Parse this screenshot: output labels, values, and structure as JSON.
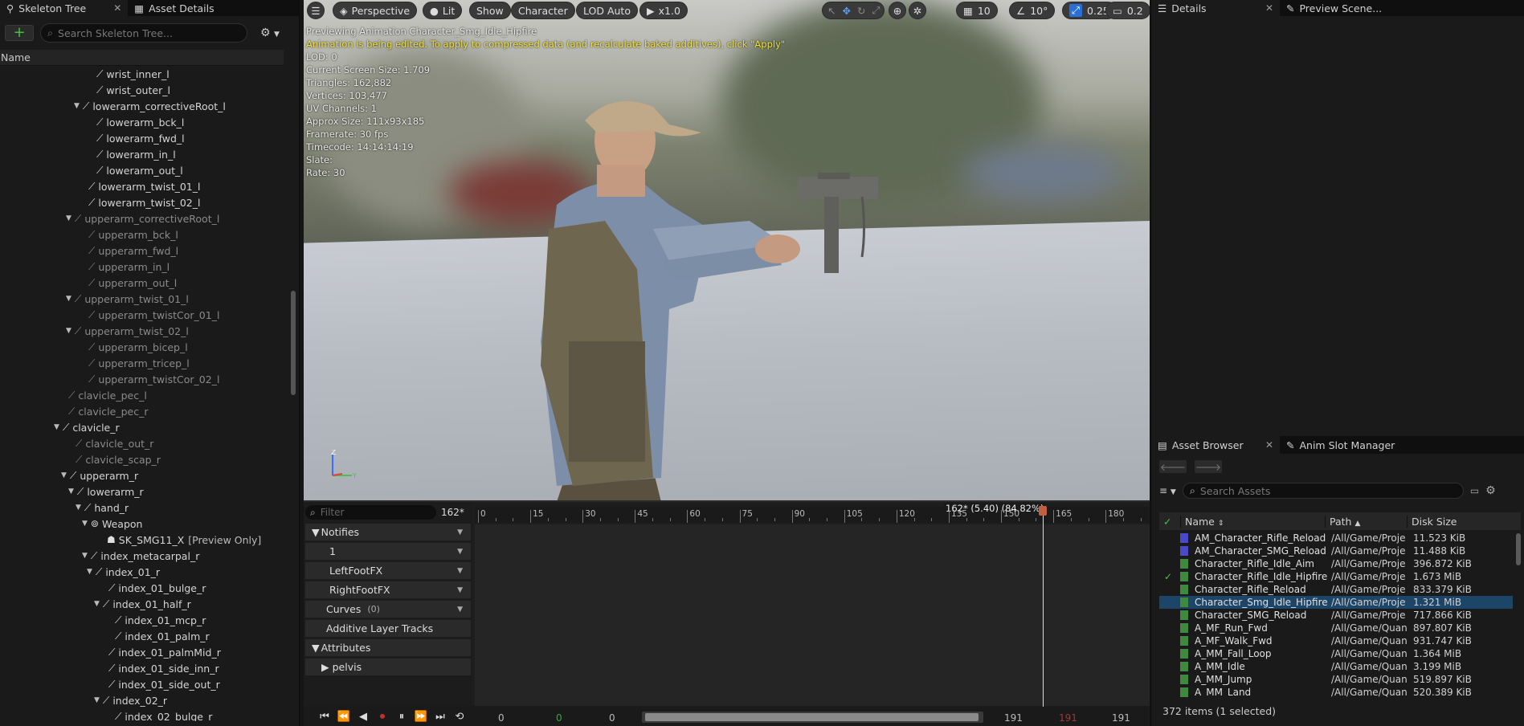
{
  "left_panel": {
    "tabs": [
      {
        "label": "Skeleton Tree"
      },
      {
        "label": "Asset Details"
      }
    ],
    "search_placeholder": "Search Skeleton Tree...",
    "column_header": "Name",
    "tree": [
      {
        "label": "wrist_inner_l",
        "dim": false
      },
      {
        "label": "wrist_outer_l",
        "dim": false
      },
      {
        "label": "lowerarm_correctiveRoot_l",
        "dim": false
      },
      {
        "label": "lowerarm_bck_l",
        "dim": false
      },
      {
        "label": "lowerarm_fwd_l",
        "dim": false
      },
      {
        "label": "lowerarm_in_l",
        "dim": false
      },
      {
        "label": "lowerarm_out_l",
        "dim": false
      },
      {
        "label": "lowerarm_twist_01_l",
        "dim": false
      },
      {
        "label": "lowerarm_twist_02_l",
        "dim": false
      },
      {
        "label": "upperarm_correctiveRoot_l",
        "dim": true
      },
      {
        "label": "upperarm_bck_l",
        "dim": true
      },
      {
        "label": "upperarm_fwd_l",
        "dim": true
      },
      {
        "label": "upperarm_in_l",
        "dim": true
      },
      {
        "label": "upperarm_out_l",
        "dim": true
      },
      {
        "label": "upperarm_twist_01_l",
        "dim": true
      },
      {
        "label": "upperarm_twistCor_01_l",
        "dim": true
      },
      {
        "label": "upperarm_twist_02_l",
        "dim": true
      },
      {
        "label": "upperarm_bicep_l",
        "dim": true
      },
      {
        "label": "upperarm_tricep_l",
        "dim": true
      },
      {
        "label": "upperarm_twistCor_02_l",
        "dim": true
      },
      {
        "label": "clavicle_pec_l",
        "dim": true
      },
      {
        "label": "clavicle_pec_r",
        "dim": true
      },
      {
        "label": "clavicle_r",
        "dim": false
      },
      {
        "label": "clavicle_out_r",
        "dim": true
      },
      {
        "label": "clavicle_scap_r",
        "dim": true
      },
      {
        "label": "upperarm_r",
        "dim": false
      },
      {
        "label": "lowerarm_r",
        "dim": false
      },
      {
        "label": "hand_r",
        "dim": false
      },
      {
        "label": "Weapon",
        "dim": false
      },
      {
        "label": "SK_SMG11_X",
        "suffix": "[Preview Only]",
        "dim": false
      },
      {
        "label": "index_metacarpal_r",
        "dim": false
      },
      {
        "label": "index_01_r",
        "dim": false
      },
      {
        "label": "index_01_bulge_r",
        "dim": false
      },
      {
        "label": "index_01_half_r",
        "dim": false
      },
      {
        "label": "index_01_mcp_r",
        "dim": false
      },
      {
        "label": "index_01_palm_r",
        "dim": false
      },
      {
        "label": "index_01_palmMid_r",
        "dim": false
      },
      {
        "label": "index_01_side_inn_r",
        "dim": false
      },
      {
        "label": "index_01_side_out_r",
        "dim": false
      },
      {
        "label": "index_02_r",
        "dim": false
      },
      {
        "label": "index_02_bulge_r",
        "dim": false
      }
    ]
  },
  "viewport": {
    "toolbar": {
      "perspective": "Perspective",
      "lit": "Lit",
      "show": "Show",
      "character": "Character",
      "lod": "LOD Auto",
      "speed": "x1.0",
      "grid": "10",
      "angle": "10°",
      "scale": "0.25",
      "camera": "0.2"
    },
    "stats": {
      "line1": "Previewing Animation Character_Smg_Idle_Hipfire",
      "line2": "Animation is being edited. To apply to compressed data (and recalculate baked additives), click \"Apply\"",
      "line3": "LOD: 0",
      "line4": "Current Screen Size: 1.709",
      "line5": "Triangles: 162,882",
      "line6": "Vertices: 103,477",
      "line7": "UV Channels: 1",
      "line8": "Approx Size: 111x93x185",
      "line9": "Framerate: 30 fps",
      "line10": "Timecode: 14:14:14:19",
      "line11": "Slate:",
      "line12": "Rate: 30"
    },
    "axis": {
      "z": "Z",
      "y": "Y"
    }
  },
  "timeline": {
    "filter_placeholder": "Filter",
    "frame_readout": "162*",
    "tracks": [
      {
        "label": "Notifies"
      },
      {
        "label": "1"
      },
      {
        "label": "LeftFootFX"
      },
      {
        "label": "RightFootFX"
      },
      {
        "label": "Curves",
        "count": "(0)"
      },
      {
        "label": "Additive Layer Tracks"
      },
      {
        "label": "Attributes"
      },
      {
        "label": "pelvis"
      }
    ],
    "ruler_labels": [
      "0",
      "15",
      "30",
      "45",
      "60",
      "75",
      "90",
      "105",
      "120",
      "135",
      "150",
      "165",
      "180"
    ],
    "ruler_max": 191,
    "current_frame": 162,
    "playhead_label": "162* (5.40) (84.82%)",
    "transport_numbers": {
      "start": "0",
      "green": "0",
      "mid": "0",
      "end1": "191",
      "end_red": "191",
      "end2": "191"
    },
    "scroll_range": [
      0.0,
      1.0
    ]
  },
  "right_panel": {
    "tabs": [
      {
        "label": "Details"
      },
      {
        "label": "Preview Scene..."
      }
    ],
    "bottom_tabs": [
      {
        "label": "Asset Browser"
      },
      {
        "label": "Anim Slot Manager"
      }
    ],
    "search_placeholder": "Search Assets",
    "columns": {
      "name": "Name",
      "path": "Path",
      "size": "Disk Size"
    },
    "assets": [
      {
        "name": "AM_Character_Rifle_Reload",
        "path": "/All/Game/Proje",
        "size": "11.523 KiB",
        "type": "montage",
        "selected": false,
        "checked": false
      },
      {
        "name": "AM_Character_SMG_Reload",
        "path": "/All/Game/Proje",
        "size": "11.488 KiB",
        "type": "montage",
        "selected": false,
        "checked": false
      },
      {
        "name": "Character_Rifle_Idle_Aim",
        "path": "/All/Game/Proje",
        "size": "396.872 KiB",
        "type": "anim",
        "selected": false,
        "checked": false
      },
      {
        "name": "Character_Rifle_Idle_Hipfire",
        "path": "/All/Game/Proje",
        "size": "1.673 MiB",
        "type": "anim",
        "selected": false,
        "checked": true
      },
      {
        "name": "Character_Rifle_Reload",
        "path": "/All/Game/Proje",
        "size": "833.379 KiB",
        "type": "anim",
        "selected": false,
        "checked": false
      },
      {
        "name": "Character_Smg_Idle_Hipfire",
        "path": "/All/Game/Proje",
        "size": "1.321 MiB",
        "type": "anim",
        "selected": true,
        "checked": false
      },
      {
        "name": "Character_SMG_Reload",
        "path": "/All/Game/Proje",
        "size": "717.866 KiB",
        "type": "anim",
        "selected": false,
        "checked": false
      },
      {
        "name": "A_MF_Run_Fwd",
        "path": "/All/Game/Quan",
        "size": "897.807 KiB",
        "type": "anim",
        "selected": false,
        "checked": false
      },
      {
        "name": "A_MF_Walk_Fwd",
        "path": "/All/Game/Quan",
        "size": "931.747 KiB",
        "type": "anim",
        "selected": false,
        "checked": false
      },
      {
        "name": "A_MM_Fall_Loop",
        "path": "/All/Game/Quan",
        "size": "1.364 MiB",
        "type": "anim",
        "selected": false,
        "checked": false
      },
      {
        "name": "A_MM_Idle",
        "path": "/All/Game/Quan",
        "size": "3.199 MiB",
        "type": "anim",
        "selected": false,
        "checked": false
      },
      {
        "name": "A_MM_Jump",
        "path": "/All/Game/Quan",
        "size": "519.897 KiB",
        "type": "anim",
        "selected": false,
        "checked": false
      },
      {
        "name": "A_MM_Land",
        "path": "/All/Game/Quan",
        "size": "520.389 KiB",
        "type": "anim",
        "selected": false,
        "checked": false
      }
    ],
    "footer": "372 items (1 selected)"
  },
  "colors": {
    "accent_blue": "#1d4568",
    "warning_yellow": "#f2e23a",
    "add_green": "#44c044",
    "record_red": "#c03030"
  }
}
